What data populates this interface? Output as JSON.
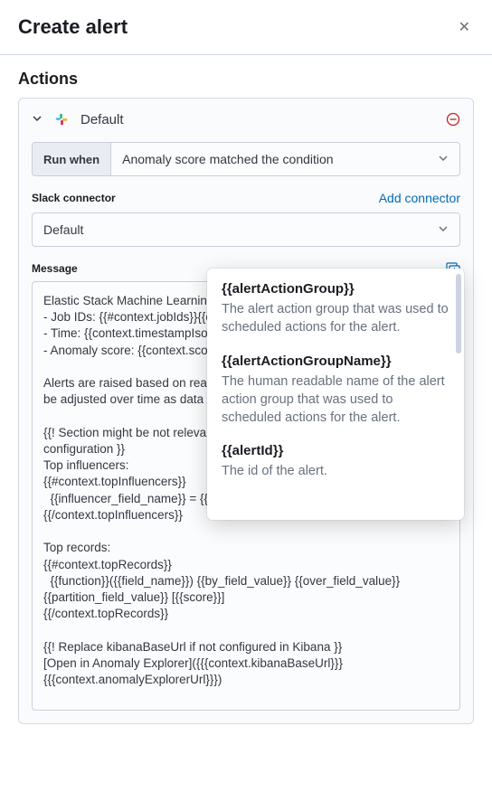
{
  "header": {
    "title": "Create alert"
  },
  "section": {
    "title": "Actions"
  },
  "action": {
    "name": "Default",
    "runWhenLabel": "Run when",
    "runWhenValue": "Anomaly score matched the condition",
    "connectorLabel": "Slack connector",
    "addConnector": "Add connector",
    "connectorValue": "Default",
    "messageLabel": "Message",
    "messageBody": "Elastic Stack Machine Learning Alert:\n- Job IDs: {{#context.jobIds}}{{context.jobIds}}\n- Time: {{context.timestampIso8601}}\n- Anomaly score: {{context.score}}\n\nAlerts are raised based on real-time scores. Remember that scores may be adjusted over time as data continues to be analyzed.\n\n{{! Section might be not relevant if selected jobs don't contain influencer configuration }}\nTop influencers:\n{{#context.topInfluencers}}\n  {{influencer_field_name}} = {{influencer_field_value}} [{{score}}]\n{{/context.topInfluencers}}\n\nTop records:\n{{#context.topRecords}}\n  {{function}}({{field_name}}) {{by_field_value}} {{over_field_value}} {{partition_field_value}} [{{score}}]\n{{/context.topRecords}}\n\n{{! Replace kibanaBaseUrl if not configured in Kibana }}\n[Open in Anomaly Explorer]({{{context.kibanaBaseUrl}}}{{{context.anomalyExplorerUrl}}})"
  },
  "varsPopover": {
    "items": [
      {
        "name": "{{alertActionGroup}}",
        "desc": "The alert action group that was used to scheduled actions for the alert."
      },
      {
        "name": "{{alertActionGroupName}}",
        "desc": "The human readable name of the alert action group that was used to scheduled actions for the alert."
      },
      {
        "name": "{{alertId}}",
        "desc": "The id of the alert."
      }
    ]
  }
}
